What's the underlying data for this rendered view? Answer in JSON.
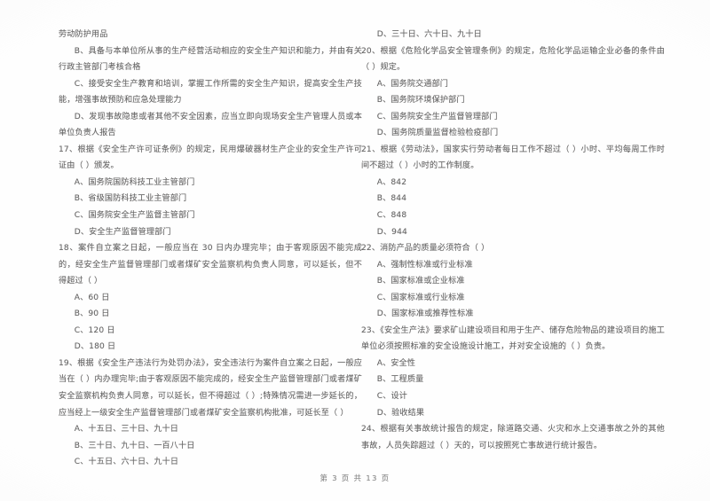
{
  "document": {
    "type": "scanned-exam-paper",
    "language": "zh-CN",
    "footer": "第 3 页  共 13 页",
    "background_color": "#ffffff",
    "ink_color": "#666565"
  },
  "left_column": {
    "blocks": [
      {
        "kind": "body",
        "text": "劳动防护用品"
      },
      {
        "kind": "option_wrap",
        "text": "B、具备与本单位所从事的生产经营活动相应的安全生产知识和能力，并由有关行政主管部门考核合格"
      },
      {
        "kind": "option_wrap",
        "text": "C、接受安全生产教育和培训，掌握工作所需的安全生产知识，提高安全生产技能，增强事故预防和应急处理能力"
      },
      {
        "kind": "option_wrap",
        "text": "D、发现事故隐患或者其他不安全因素，应当立即向现场安全生产管理人员或本单位负责人报告"
      },
      {
        "kind": "stem",
        "text": "17、根据《安全生产许可证条例》的规定，民用爆破器材生产企业的安全生产许可证由（   ）颁发。"
      },
      {
        "kind": "option",
        "text": "A、国务院国防科技工业主管部门"
      },
      {
        "kind": "option",
        "text": "B、省级国防科技工业主管部门"
      },
      {
        "kind": "option",
        "text": "C、国务院安全生产监督主管部门"
      },
      {
        "kind": "option",
        "text": "D、安全生产监督管理部门"
      },
      {
        "kind": "stem",
        "text": "18、案件自立案之日起，一般应当在 30 日内办理完毕；由于客观原因不能完成的，经安全生产监督管理部门或者煤矿安全监察机构负责人同意，可以延长，但不得超过（     ）"
      },
      {
        "kind": "option",
        "text": "A、60 日"
      },
      {
        "kind": "option",
        "text": "B、90 日"
      },
      {
        "kind": "option",
        "text": "C、120 日"
      },
      {
        "kind": "option",
        "text": "D、180 日"
      },
      {
        "kind": "stem",
        "text": "19、根据《安全生产违法行为处罚办法》，安全违法行为案件自立案之日起，一般应当在（   ）内办理完毕;由于客观原因不能完成的，经安全生产监督管理部门或者煤矿安全监察机构负责人同意，可以延长，但不得超过（     ）;特殊情况需进一步延长的，应当经上一级安全生产监督管理部门或者煤矿安全监察机构批准，可延长至（     ）"
      },
      {
        "kind": "option",
        "text": "A、十五日、三十日、九十日"
      },
      {
        "kind": "option",
        "text": "B、三十日、九十日、一百八十日"
      },
      {
        "kind": "option",
        "text": "C、十五日、六十日、九十日"
      }
    ]
  },
  "right_column": {
    "blocks": [
      {
        "kind": "option",
        "text": "D、三十日、六十日、九十日"
      },
      {
        "kind": "stem",
        "text": "20、根据《危险化学品安全管理条例》的规定，危险化学品运输企业必备的条件由（     ）规定。"
      },
      {
        "kind": "option",
        "text": "A、国务院交通部门"
      },
      {
        "kind": "option",
        "text": "B、国务院环境保护部门"
      },
      {
        "kind": "option",
        "text": "C、国务院安全生产监督管理部门"
      },
      {
        "kind": "option",
        "text": "D、国务院质量监督检验检疫部门"
      },
      {
        "kind": "stem",
        "text": "21、根据《劳动法》，国家实行劳动者每日工作不超过（     ）小时、平均每周工作时间不超过（   ）小时的工作制度。"
      },
      {
        "kind": "option",
        "text": "A、842"
      },
      {
        "kind": "option",
        "text": "B、844"
      },
      {
        "kind": "option",
        "text": "C、848"
      },
      {
        "kind": "option",
        "text": "D、944"
      },
      {
        "kind": "stem",
        "text": "22、消防产品的质量必须符合（     ）"
      },
      {
        "kind": "option",
        "text": "A、强制性标准或行业标准"
      },
      {
        "kind": "option",
        "text": "B、国家标准或企业标准"
      },
      {
        "kind": "option",
        "text": "C、国家标准或行业标准"
      },
      {
        "kind": "option",
        "text": "D、国家标准或推荐性标准"
      },
      {
        "kind": "stem",
        "text": "23、《安全生产法》要求矿山建设项目和用于生产、储存危险物品的建设项目的施工单位必须按照标准的安全设施设计施工，并对安全设施的（   ）负责。"
      },
      {
        "kind": "option",
        "text": "A、安全性"
      },
      {
        "kind": "option",
        "text": "B、工程质量"
      },
      {
        "kind": "option",
        "text": "C、设计"
      },
      {
        "kind": "option",
        "text": "D、验收结果"
      },
      {
        "kind": "stem",
        "text": "24、根据有关事故统计报告的规定，除道路交通、火灾和水上交通事故之外的其他事故，人员失踪超过（   ）天的，可以按照死亡事故进行统计报告。"
      }
    ]
  }
}
